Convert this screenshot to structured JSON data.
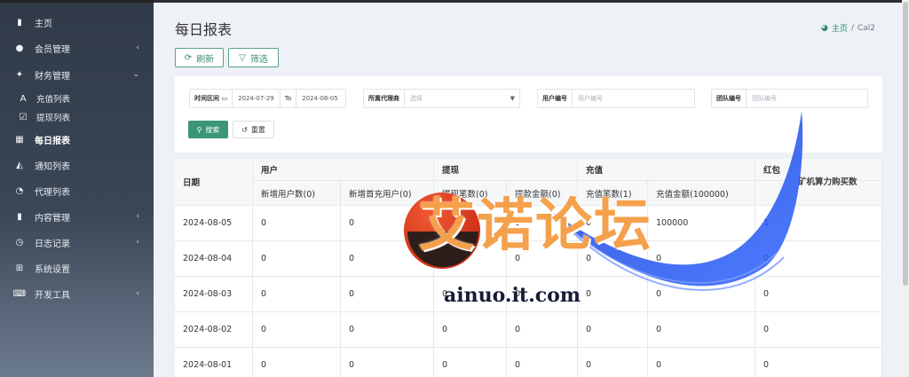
{
  "sidebar": {
    "items": [
      {
        "label": "主页",
        "icon": "bar-chart-icon",
        "glyph": "▮",
        "active": false,
        "chevron": ""
      },
      {
        "label": "会员管理",
        "icon": "user-icon",
        "glyph": "●",
        "active": false,
        "chevron": "‹"
      },
      {
        "label": "财务管理",
        "icon": "finance-icon",
        "glyph": "✦",
        "active": false,
        "chevron": "⌄"
      },
      {
        "label": "充值列表",
        "icon": "font-a-icon",
        "glyph": "A",
        "active": false,
        "chevron": "",
        "sub": true
      },
      {
        "label": "提现列表",
        "icon": "checkbox-icon",
        "glyph": "☑",
        "active": false,
        "chevron": "",
        "sub": true
      },
      {
        "label": "每日报表",
        "icon": "calendar-icon",
        "glyph": "▦",
        "active": true,
        "chevron": ""
      },
      {
        "label": "通知列表",
        "icon": "bell-icon",
        "glyph": "◭",
        "active": false,
        "chevron": ""
      },
      {
        "label": "代理列表",
        "icon": "clock-icon",
        "glyph": "◔",
        "active": false,
        "chevron": ""
      },
      {
        "label": "内容管理",
        "icon": "bookmark-icon",
        "glyph": "▮",
        "active": false,
        "chevron": "‹"
      },
      {
        "label": "日志记录",
        "icon": "history-icon",
        "glyph": "◷",
        "active": false,
        "chevron": "‹"
      },
      {
        "label": "系统设置",
        "icon": "windows-icon",
        "glyph": "⊞",
        "active": false,
        "chevron": ""
      },
      {
        "label": "开发工具",
        "icon": "keyboard-icon",
        "glyph": "⌨",
        "active": false,
        "chevron": "‹"
      }
    ]
  },
  "header": {
    "title": "每日报表",
    "breadcrumb": {
      "home": "主页",
      "separator": "/",
      "current": "Cal2"
    }
  },
  "toolbar": {
    "refresh_label": "刷新",
    "filter_label": "筛选"
  },
  "filters": {
    "date_range": {
      "label": "时间区间",
      "start": "2024-07-29",
      "to": "To",
      "end": "2024-08-05"
    },
    "agent": {
      "label": "所属代理商",
      "placeholder": "选择"
    },
    "user_id": {
      "label": "用户编号",
      "placeholder": "用户编号"
    },
    "team_id": {
      "label": "团队编号",
      "placeholder": "团队编号"
    },
    "search_label": "搜索",
    "reset_label": "重置"
  },
  "table": {
    "col_date": "日期",
    "group_user": "用户",
    "group_withdraw": "提现",
    "group_recharge": "充值",
    "group_redpacket": "红包",
    "extra_header": "矿机算力购买数",
    "sub_headers": [
      "新增用户数(0)",
      "新增首充用户(0)",
      "提现笔数(0)",
      "提款金额(0)",
      "充值笔数(1)",
      "充值金额(100000)"
    ],
    "rows": [
      {
        "date": "2024-08-05",
        "values": [
          "0",
          "0",
          "0",
          "0",
          "0",
          "100000",
          "1"
        ]
      },
      {
        "date": "2024-08-04",
        "values": [
          "0",
          "0",
          "0",
          "0",
          "0",
          "0",
          "0"
        ]
      },
      {
        "date": "2024-08-03",
        "values": [
          "0",
          "0",
          "0",
          "0",
          "0",
          "0",
          "0"
        ]
      },
      {
        "date": "2024-08-02",
        "values": [
          "0",
          "0",
          "0",
          "0",
          "0",
          "0",
          "0"
        ]
      },
      {
        "date": "2024-08-01",
        "values": [
          "0",
          "0",
          "0",
          "0",
          "0",
          "0",
          "0"
        ]
      }
    ]
  },
  "watermark": {
    "title": "艾诺论坛",
    "url": "ainuo.it.com"
  },
  "colors": {
    "accent": "#3b9576",
    "sidebar_top": "#303a48",
    "watermark_orange": "#f5a14c"
  }
}
